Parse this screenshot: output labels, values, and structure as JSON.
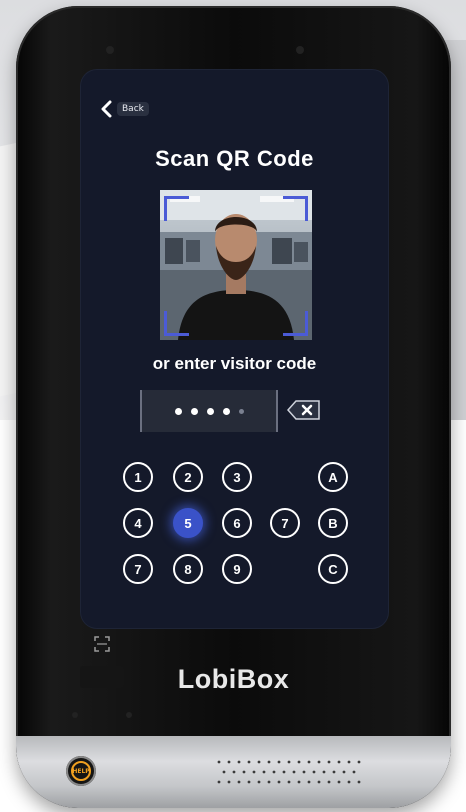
{
  "screen": {
    "back_label": "Back",
    "title": "Scan QR Code",
    "subtitle": "or enter visitor code",
    "code": {
      "entered_digits": 4,
      "length": 5
    }
  },
  "keypad": {
    "row1": [
      "1",
      "2",
      "3",
      "A"
    ],
    "row2": [
      "4",
      "5",
      "6",
      "7",
      "B"
    ],
    "row3": [
      "7",
      "8",
      "9",
      "C"
    ],
    "pressed_key": "5"
  },
  "device": {
    "brand": "LobiBox",
    "help_label": "HELP"
  },
  "colors": {
    "screen_bg": "#14192a",
    "accent": "#3a52c8",
    "scan_frame": "#4b5bd6",
    "help": "#f0a020"
  },
  "icons": [
    "chevron-left-icon",
    "backspace-icon",
    "scan-frame-icon",
    "help-icon",
    "speaker-grille-icon"
  ]
}
